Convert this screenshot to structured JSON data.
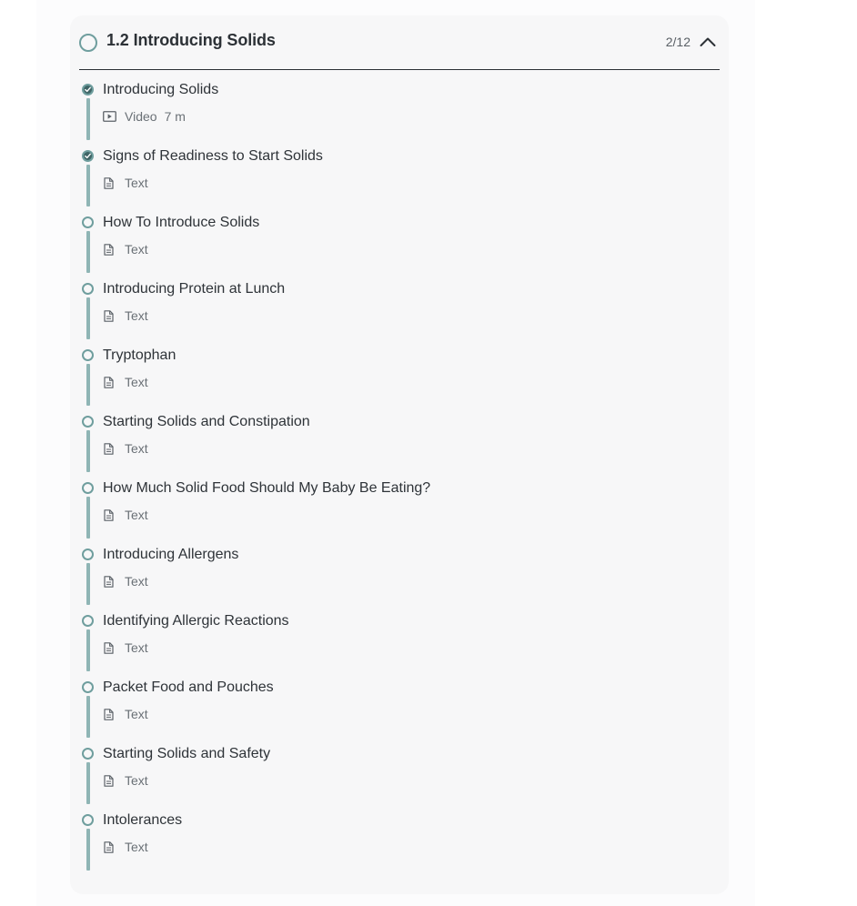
{
  "section": {
    "title": "1.2 Introducing Solids",
    "progress": "2/12",
    "collapse_icon": "chevron-up-icon"
  },
  "lessons": [
    {
      "title": "Introducing Solids",
      "type": "Video",
      "duration": "7 m",
      "completed": true
    },
    {
      "title": "Signs of Readiness to Start Solids",
      "type": "Text",
      "completed": true
    },
    {
      "title": "How To Introduce Solids",
      "type": "Text",
      "completed": false
    },
    {
      "title": "Introducing Protein at Lunch",
      "type": "Text",
      "completed": false
    },
    {
      "title": "Tryptophan",
      "type": "Text",
      "completed": false
    },
    {
      "title": "Starting Solids and Constipation",
      "type": "Text",
      "completed": false
    },
    {
      "title": "How Much Solid Food Should My Baby Be Eating?",
      "type": "Text",
      "completed": false
    },
    {
      "title": "Introducing Allergens",
      "type": "Text",
      "completed": false
    },
    {
      "title": "Identifying Allergic Reactions",
      "type": "Text",
      "completed": false
    },
    {
      "title": "Packet Food and Pouches",
      "type": "Text",
      "completed": false
    },
    {
      "title": "Starting Solids and Safety",
      "type": "Text",
      "completed": false
    },
    {
      "title": "Intolerances",
      "type": "Text",
      "completed": false
    }
  ],
  "colors": {
    "accent": "#6f9e9e",
    "accent_dark": "#3f6566",
    "track": "#8fb5b5"
  }
}
